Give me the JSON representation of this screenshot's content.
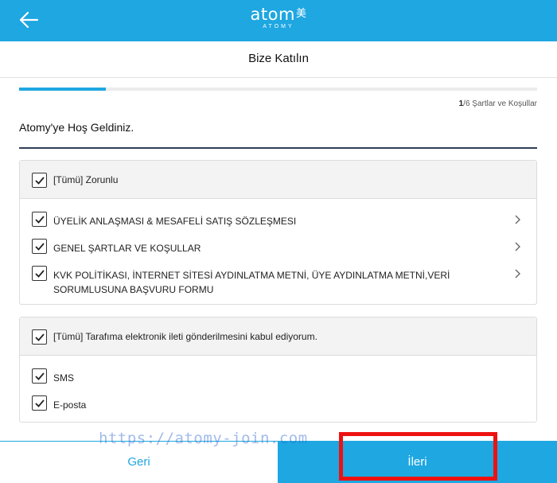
{
  "header": {
    "logo_text": "atom",
    "logo_mark": "美",
    "logo_sub": "ATOMY",
    "back_icon": "arrow-left-icon",
    "background_color": "#1ea7e1"
  },
  "page": {
    "title": "Bize Katılın"
  },
  "progress": {
    "current": "1",
    "total": "/6",
    "label": "Şartlar ve Koşullar",
    "fraction": 0.1667
  },
  "welcome": "Atomy'ye Hoş Geldiniz.",
  "groups": [
    {
      "header_label": "[Tümü] Zorunlu",
      "checked": true,
      "items": [
        {
          "label": "ÜYELİK ANLAŞMASI & MESAFELİ SATIŞ SÖZLEŞMESI",
          "checked": true,
          "has_chevron": true
        },
        {
          "label": "GENEL ŞARTLAR VE KOŞULLAR",
          "checked": true,
          "has_chevron": true
        },
        {
          "label": "KVK POLİTİKASI, İNTERNET SİTESİ AYDINLATMA METNİ, ÜYE AYDINLATMA METNİ,VERİ SORUMLUSUNA BAŞVURU FORMU",
          "checked": true,
          "has_chevron": true
        }
      ]
    },
    {
      "header_label": "[Tümü] Tarafıma elektronik ileti gönderilmesini kabul ediyorum.",
      "checked": true,
      "items": [
        {
          "label": "SMS",
          "checked": true,
          "has_chevron": false
        },
        {
          "label": "E-posta",
          "checked": true,
          "has_chevron": false
        }
      ]
    }
  ],
  "footer": {
    "back_label": "Geri",
    "next_label": "İleri"
  },
  "watermark": "https://atomy-join.com",
  "colors": {
    "accent": "#1ea7e1",
    "highlight": "#ee1111",
    "rule": "#2f3e57"
  }
}
